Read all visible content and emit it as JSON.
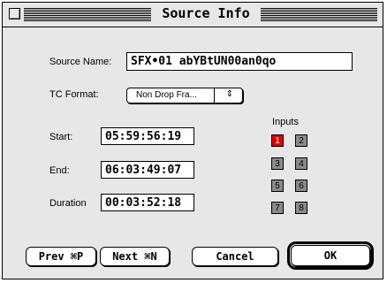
{
  "window": {
    "title": "Source Info"
  },
  "source": {
    "label": "Source Name:",
    "value": "SFX•01 abYBtUN00an0qo"
  },
  "tc_format": {
    "label": "TC Format:",
    "selected": "Non Drop Fra...",
    "arrow": "⇕"
  },
  "inputs": {
    "header": "Inputs",
    "buttons": [
      "1",
      "2",
      "3",
      "4",
      "5",
      "6",
      "7",
      "8"
    ],
    "active": "1",
    "active_color": "#e00000",
    "inactive_color": "#8a8a8a"
  },
  "times": {
    "start_label": "Start:",
    "start_value": "05:59:56:19",
    "end_label": "End:",
    "end_value": "06:03:49:07",
    "duration_label": "Duration",
    "duration_value": "00:03:52:18"
  },
  "buttons": {
    "prev": "Prev ⌘P",
    "next": "Next ⌘N",
    "cancel": "Cancel",
    "ok": "OK"
  }
}
